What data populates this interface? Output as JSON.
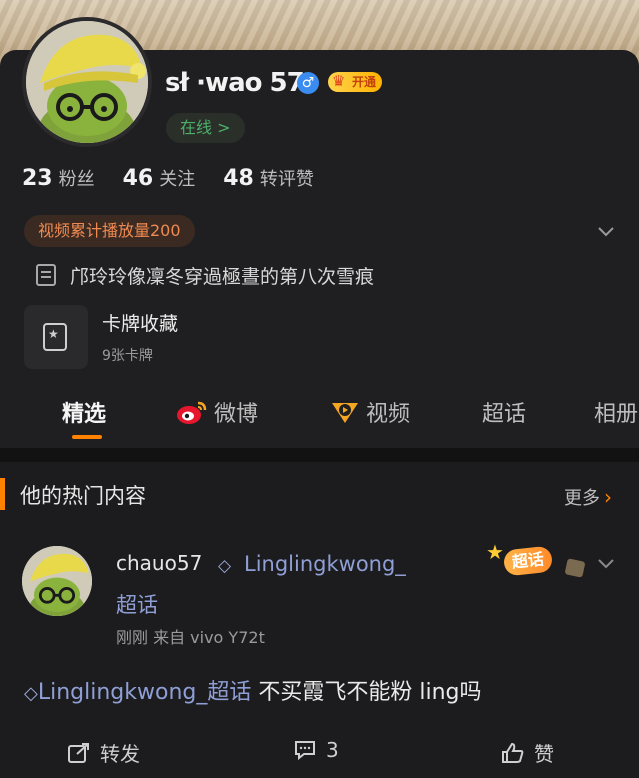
{
  "profile": {
    "username": "sł ·wao 57",
    "online_status": "在线 >",
    "vip_label": "开通",
    "stats": [
      {
        "num": "23",
        "label": "粉丝"
      },
      {
        "num": "46",
        "label": "关注"
      },
      {
        "num": "48",
        "label": "转评赞"
      }
    ],
    "video_plays": "视频累计播放量200",
    "bio": "邝玲玲像凜冬穿過極晝的第八次雪痕",
    "cards": {
      "title": "卡牌收藏",
      "count": "9张卡牌"
    }
  },
  "tabs": [
    {
      "label": "精选",
      "active": true
    },
    {
      "label": "微博"
    },
    {
      "label": "视频"
    },
    {
      "label": "超话"
    },
    {
      "label": "相册"
    }
  ],
  "section": {
    "title": "他的热门内容",
    "more": "更多"
  },
  "post": {
    "user": "chauo57",
    "topic_line1": "Linglingkwong_",
    "topic_line2": "超话",
    "meta": "刚刚  来自 vivo Y72t",
    "badge": "超话",
    "text_link": "Linglingkwong_超话",
    "text_body": " 不买霞飞不能粉 ling吗",
    "actions": {
      "repost": "转发",
      "comment": "3",
      "like": "赞"
    }
  },
  "colors": {
    "accent": "#ff8200",
    "link": "#8f9fd6",
    "online": "#4caf6a",
    "bg": "#1f1f21"
  }
}
